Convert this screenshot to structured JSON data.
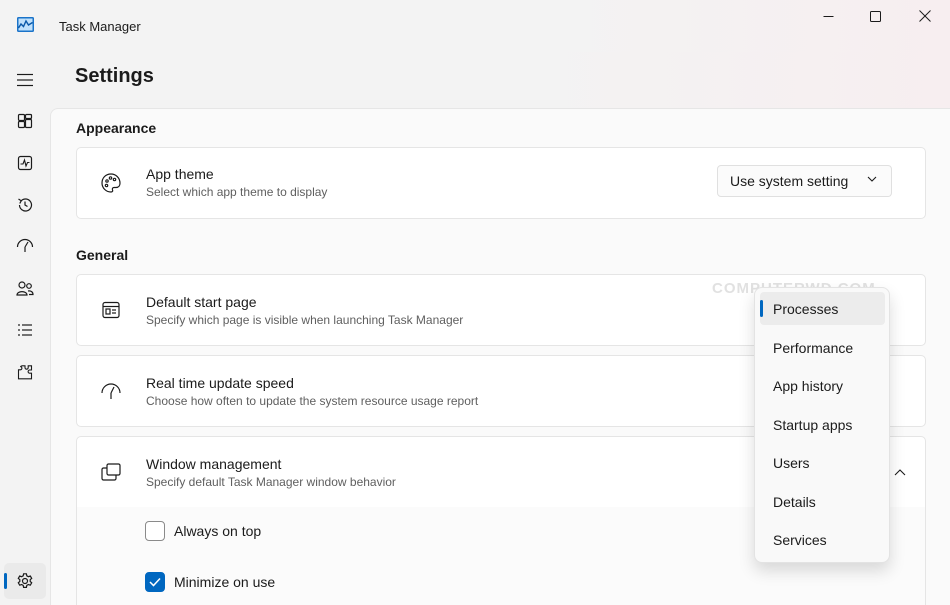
{
  "window": {
    "title": "Task Manager",
    "icon": "task-manager-icon",
    "controls": [
      "minimize-icon",
      "maximize-icon",
      "close-icon"
    ]
  },
  "nav": {
    "items": [
      {
        "icon": "hamburger-menu-icon"
      },
      {
        "icon": "processes-icon"
      },
      {
        "icon": "performance-icon"
      },
      {
        "icon": "app-history-icon"
      },
      {
        "icon": "startup-apps-icon"
      },
      {
        "icon": "users-icon"
      },
      {
        "icon": "details-icon"
      },
      {
        "icon": "services-icon"
      },
      {
        "icon": "settings-gear-icon",
        "active": true
      }
    ]
  },
  "page": {
    "title": "Settings"
  },
  "appearance": {
    "label": "Appearance",
    "app_theme": {
      "title": "App theme",
      "description": "Select which app theme to display",
      "value": "Use system setting",
      "icon": "palette-icon"
    }
  },
  "general": {
    "label": "General",
    "default_start_page": {
      "title": "Default start page",
      "description": "Specify which page is visible when launching Task Manager",
      "icon": "start-page-icon"
    },
    "update_speed": {
      "title": "Real time update speed",
      "description": "Choose how often to update the system resource usage report",
      "icon": "speedometer-icon"
    },
    "window_management": {
      "title": "Window management",
      "description": "Specify default Task Manager window behavior",
      "icon": "windows-stack-icon",
      "options": [
        {
          "label": "Always on top",
          "checked": false
        },
        {
          "label": "Minimize on use",
          "checked": true
        }
      ]
    }
  },
  "start_page_dropdown": {
    "selected": "Processes",
    "options": [
      "Processes",
      "Performance",
      "App history",
      "Startup apps",
      "Users",
      "Details",
      "Services"
    ]
  },
  "watermark": "COMPUTERWD.COM",
  "colors": {
    "accent": "#0067c0"
  }
}
